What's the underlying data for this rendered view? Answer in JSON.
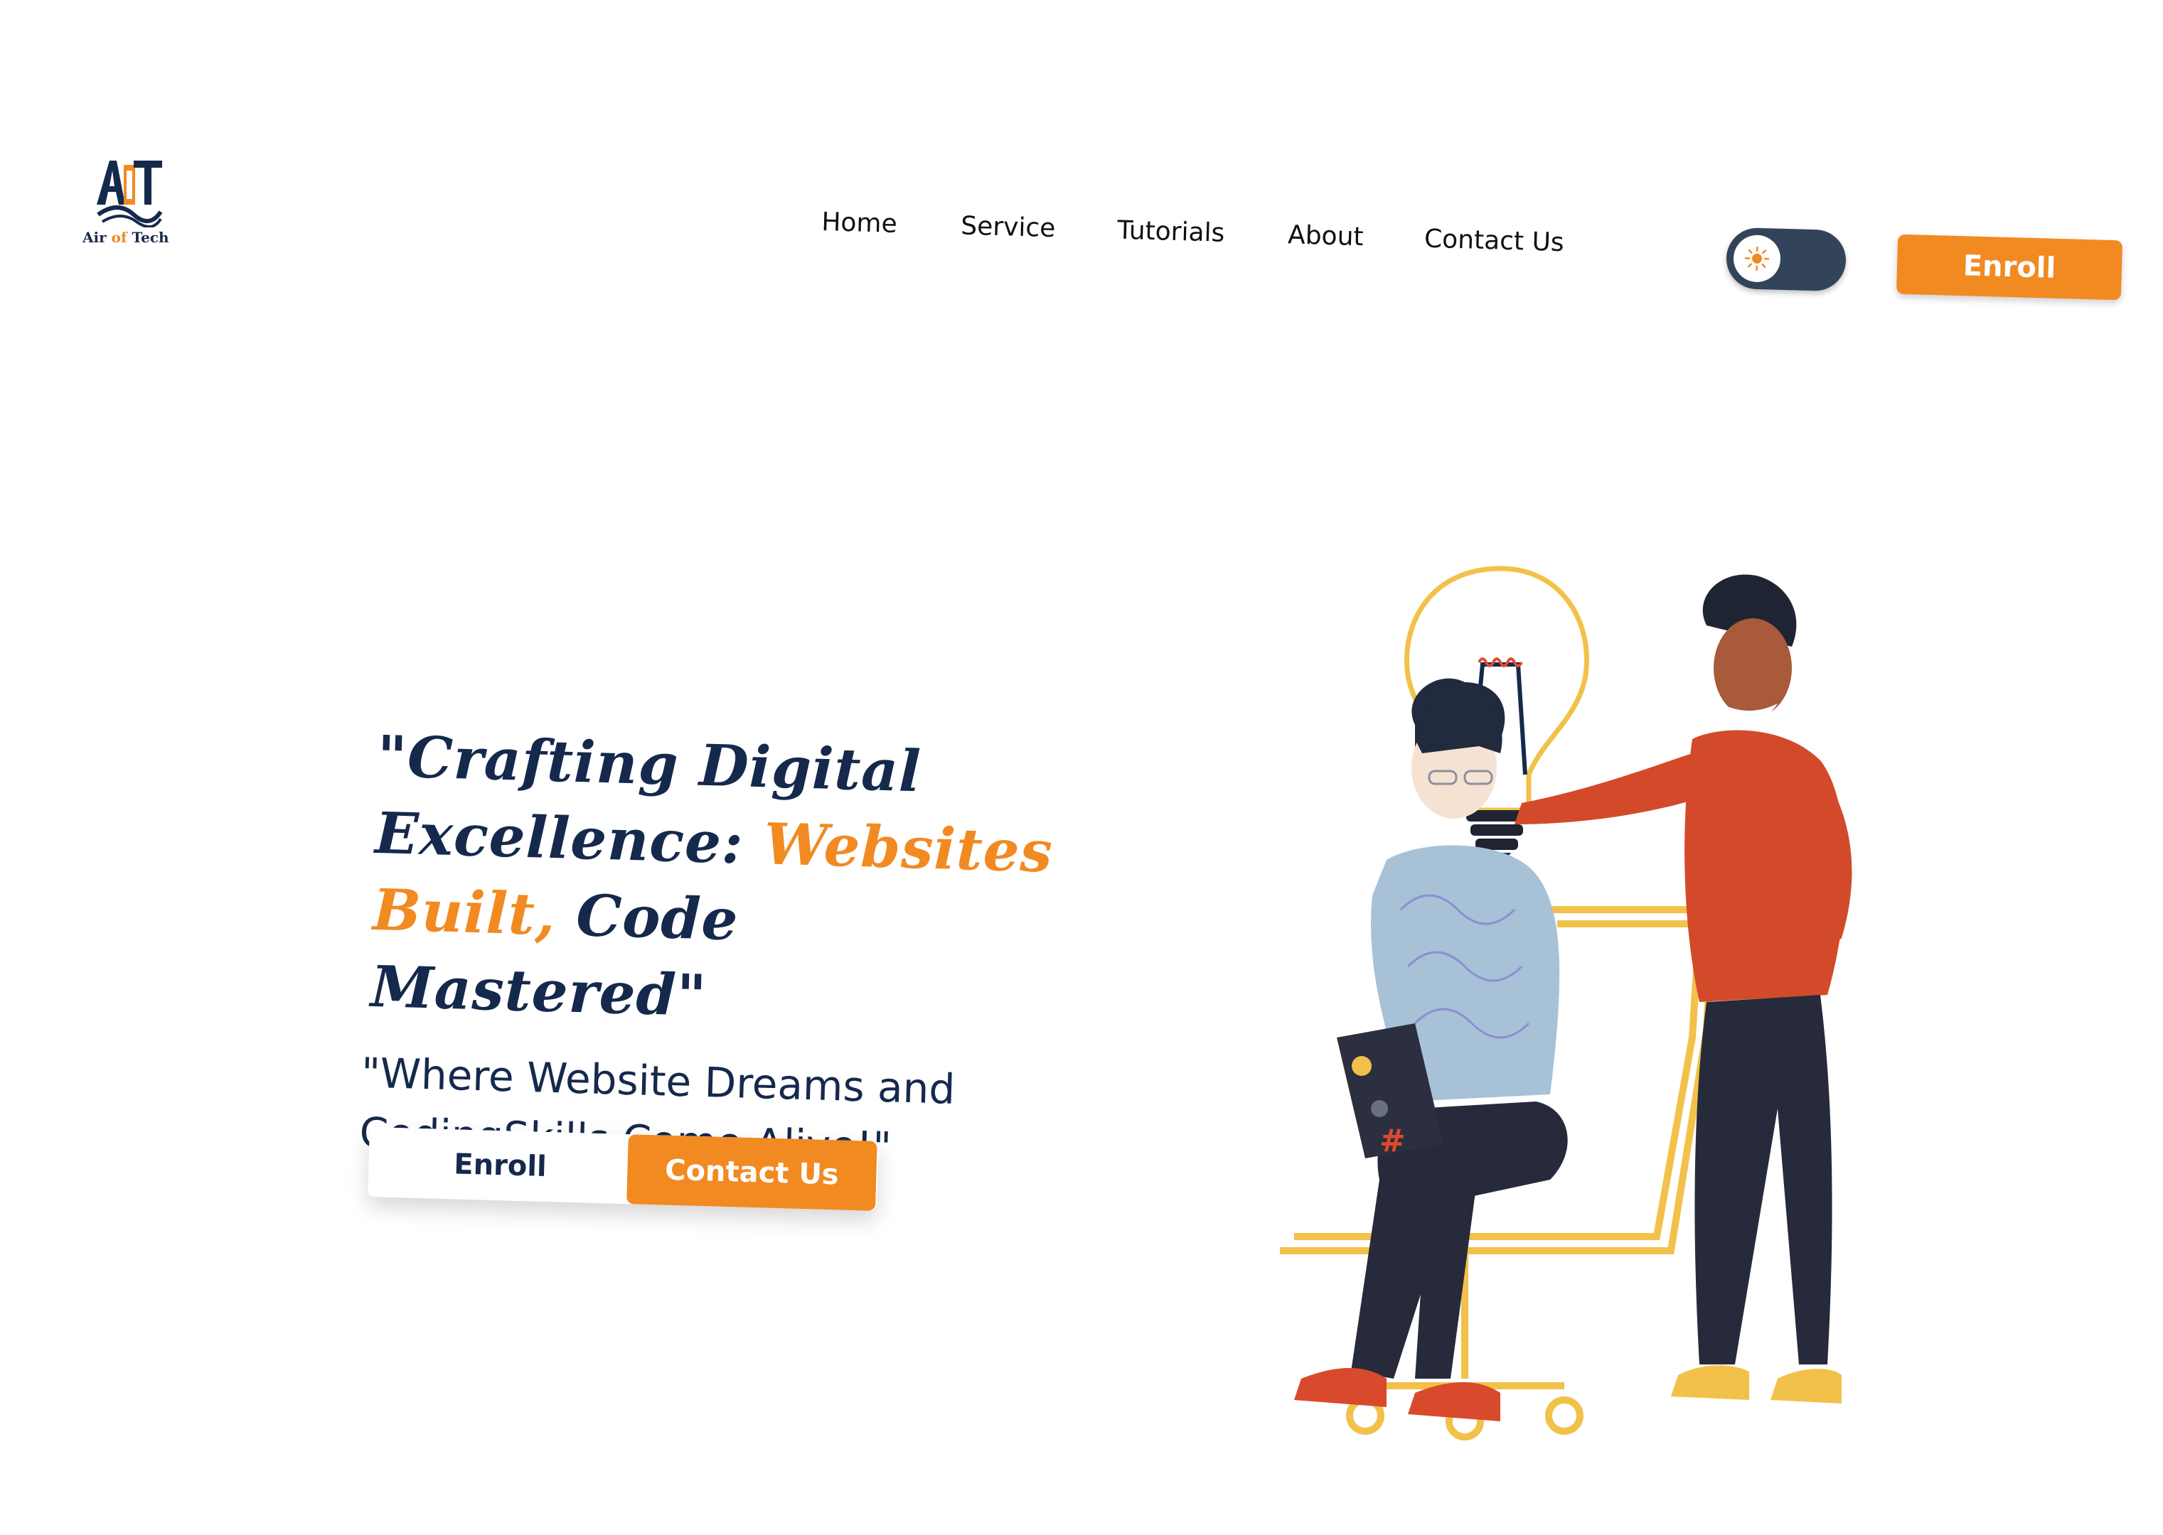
{
  "brand": {
    "logo_letters": "AOT",
    "name_part1": "Air ",
    "name_part2": "of",
    "name_part3": " Tech"
  },
  "nav": {
    "items": [
      {
        "label": "Home"
      },
      {
        "label": "Service"
      },
      {
        "label": "Tutorials"
      },
      {
        "label": "About"
      },
      {
        "label": "Contact Us"
      }
    ]
  },
  "header": {
    "theme_toggle_icon": "sun-icon",
    "enroll_label": "Enroll"
  },
  "hero": {
    "headline_part1": "\"Crafting Digital Excellence: ",
    "headline_highlight": "Websites Built,",
    "headline_part2": " Code Mastered\"",
    "subheadline": "\"Where Website Dreams and CodingSkills Come Alive!\"",
    "enroll_label": "Enroll",
    "contact_label": "Contact Us"
  },
  "colors": {
    "accent": "#f28a22",
    "navy": "#15294d",
    "toggle": "#33435a"
  }
}
